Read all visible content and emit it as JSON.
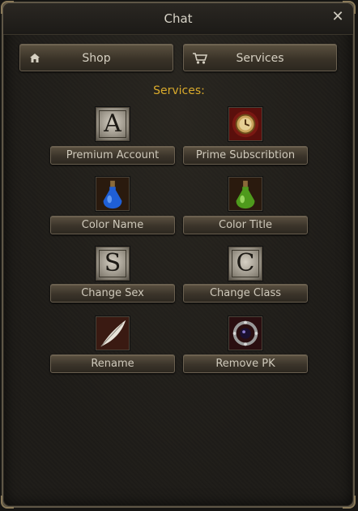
{
  "window": {
    "title": "Chat",
    "close_glyph": "✕"
  },
  "nav": {
    "shop_label": "Shop",
    "shop_icon": "home-icon",
    "services_label": "Services",
    "services_icon": "cart-icon"
  },
  "section": {
    "title": "Services:"
  },
  "services": [
    {
      "label": "Premium Account",
      "icon": "letter-a-icon",
      "glyph": "A"
    },
    {
      "label": "Prime Subscribtion",
      "icon": "clock-coin-icon"
    },
    {
      "label": "Color Name",
      "icon": "blue-potion-icon"
    },
    {
      "label": "Color Title",
      "icon": "green-potion-icon"
    },
    {
      "label": "Change Sex",
      "icon": "letter-s-icon",
      "glyph": "S"
    },
    {
      "label": "Change Class",
      "icon": "letter-c-icon",
      "glyph": "C"
    },
    {
      "label": "Rename",
      "icon": "feather-quill-icon"
    },
    {
      "label": "Remove PK",
      "icon": "gem-ring-icon"
    }
  ],
  "colors": {
    "section_title": "#d9aa2c",
    "button_text": "#cfc9bb",
    "background": "#1e1c19"
  }
}
